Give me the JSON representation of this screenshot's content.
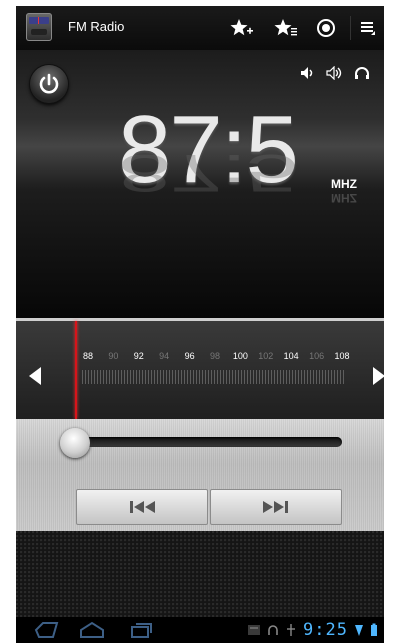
{
  "app": {
    "title": "FM Radio"
  },
  "header": {
    "actions": [
      {
        "name": "add-favorite",
        "icon": "star-plus-icon"
      },
      {
        "name": "favorites-list",
        "icon": "star-list-icon"
      },
      {
        "name": "record",
        "icon": "record-icon"
      },
      {
        "name": "overflow-menu",
        "icon": "menu-icon"
      }
    ]
  },
  "display": {
    "frequency": "87:5",
    "unit": "MHZ",
    "audio_icons": [
      "speaker-icon",
      "speaker-low-icon",
      "headphones-icon"
    ]
  },
  "tuner": {
    "scale": [
      {
        "label": "88",
        "dim": false
      },
      {
        "label": "90",
        "dim": true
      },
      {
        "label": "92",
        "dim": false
      },
      {
        "label": "94",
        "dim": true
      },
      {
        "label": "96",
        "dim": false
      },
      {
        "label": "98",
        "dim": true
      },
      {
        "label": "100",
        "dim": false
      },
      {
        "label": "102",
        "dim": true
      },
      {
        "label": "104",
        "dim": false
      },
      {
        "label": "106",
        "dim": true
      },
      {
        "label": "108",
        "dim": false
      }
    ],
    "current_frequency": 87.5,
    "range": [
      87.5,
      108
    ]
  },
  "volume": {
    "level": 0
  },
  "controls": {
    "prev_icon": "skip-previous-icon",
    "next_icon": "skip-next-icon"
  },
  "system_bar": {
    "time": "9:25",
    "nav": [
      "back-icon",
      "home-icon",
      "recent-apps-icon"
    ],
    "accent": "#4fb7ff"
  },
  "colors": {
    "needle": "#d8141a",
    "clock": "#4fb7ff"
  }
}
